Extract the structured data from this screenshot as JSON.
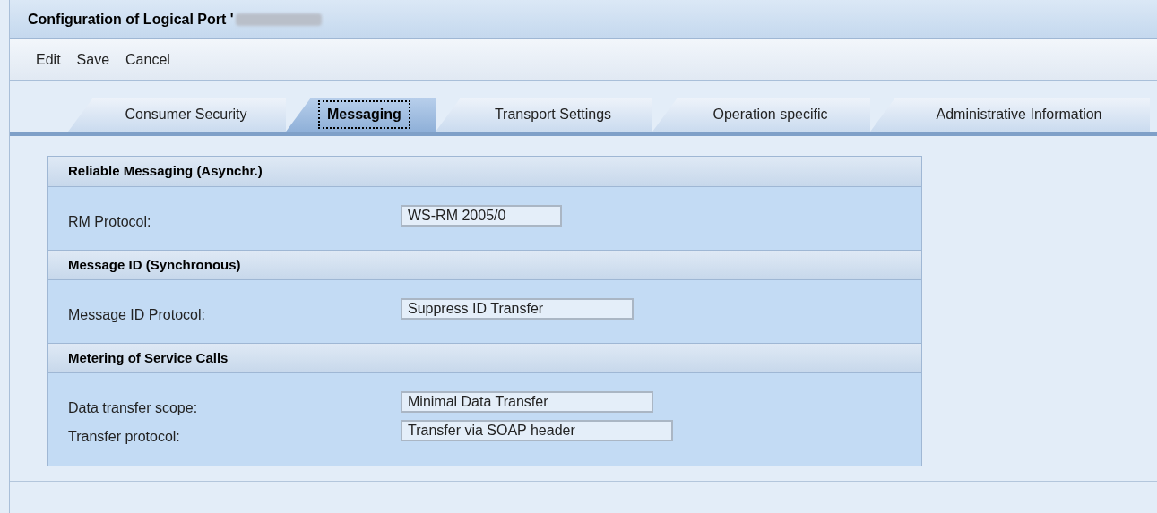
{
  "window": {
    "title": "Configuration of Logical Port '"
  },
  "toolbar": [
    "Edit",
    "Save",
    "Cancel"
  ],
  "tabs": [
    {
      "label": "Consumer Security",
      "selected": false
    },
    {
      "label": "Messaging",
      "selected": true
    },
    {
      "label": "Transport Settings",
      "selected": false
    },
    {
      "label": "Operation specific",
      "selected": false
    },
    {
      "label": "Administrative Information",
      "selected": false
    }
  ],
  "sections": [
    {
      "title": "Reliable Messaging (Asynchr.)",
      "fields": [
        {
          "label": "RM Protocol:",
          "value": "WS-RM 2005/0"
        }
      ]
    },
    {
      "title": "Message ID (Synchronous)",
      "fields": [
        {
          "label": "Message ID Protocol:",
          "value": "Suppress ID Transfer"
        }
      ]
    },
    {
      "title": "Metering of Service Calls",
      "fields": [
        {
          "label": "Data transfer scope:",
          "value": "Minimal Data Transfer"
        },
        {
          "label": "Transfer protocol:",
          "value": "Transfer via SOAP header"
        }
      ]
    }
  ]
}
